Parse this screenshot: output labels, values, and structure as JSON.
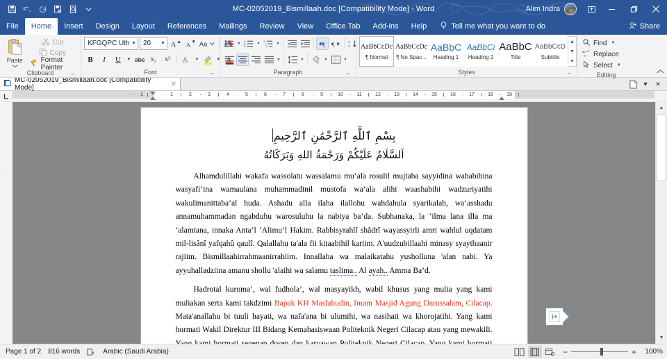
{
  "titlebar": {
    "quick_access": [
      "save-icon",
      "undo-icon",
      "redo-icon",
      "quick-print-icon",
      "print-preview-icon",
      "customize-qat-icon"
    ],
    "document_title": "MC-02052019_Bismillaah.doc [Compatibility Mode]  -  Word",
    "user_name": "Alim Indra",
    "ribbon_display_options": "ribbon-display-icon",
    "minimize": "minimize-icon",
    "restore": "restore-icon",
    "close": "close-icon"
  },
  "ribbon_tabs": [
    {
      "label": "File",
      "active": false
    },
    {
      "label": "Home",
      "active": true
    },
    {
      "label": "Insert",
      "active": false
    },
    {
      "label": "Design",
      "active": false
    },
    {
      "label": "Layout",
      "active": false
    },
    {
      "label": "References",
      "active": false
    },
    {
      "label": "Mailings",
      "active": false
    },
    {
      "label": "Review",
      "active": false
    },
    {
      "label": "View",
      "active": false
    },
    {
      "label": "Office Tab",
      "active": false
    },
    {
      "label": "Add-ins",
      "active": false
    },
    {
      "label": "Help",
      "active": false
    }
  ],
  "tell_me": {
    "placeholder": "Tell me what you want to do",
    "icon": "lightbulb-icon"
  },
  "share": {
    "label": "Share",
    "icon": "share-person-icon"
  },
  "ribbon": {
    "clipboard": {
      "label": "Clipboard",
      "paste_label": "Paste",
      "cut_label": "Cut",
      "copy_label": "Copy",
      "format_painter_label": "Format Painter",
      "dialog_launcher": "dialog-launcher-icon"
    },
    "font": {
      "label": "Font",
      "font_name": "KFGQPC Uth",
      "font_size": "20",
      "grow_font": "A",
      "shrink_font": "A",
      "change_case": "Aa",
      "clear_formatting": "clear-formatting-icon",
      "bold": "B",
      "italic": "I",
      "underline": "U",
      "strikethrough": "abc",
      "subscript": "x₂",
      "superscript": "x²",
      "text_effects": "text-effects-icon",
      "highlight": "highlight-icon",
      "font_color": "A",
      "dialog_launcher": "dialog-launcher-icon"
    },
    "paragraph": {
      "label": "Paragraph",
      "buttons_row1": [
        "bullets-icon",
        "numbering-icon",
        "multilevel-list-icon",
        "decrease-indent-icon",
        "increase-indent-icon",
        "ltr-text-direction-icon",
        "rtl-text-direction-icon",
        "sort-icon",
        "show-formatting-marks-icon"
      ],
      "buttons_row2": [
        "align-left-icon",
        "align-center-icon",
        "align-right-icon",
        "justify-icon",
        "line-spacing-icon",
        "shading-icon",
        "borders-icon"
      ],
      "dialog_launcher": "dialog-launcher-icon"
    },
    "styles": {
      "label": "Styles",
      "items": [
        {
          "preview": "AaBbCcDc",
          "name": "¶ Normal",
          "selected": true
        },
        {
          "preview": "AaBbCcDc",
          "name": "¶ No Spac...",
          "selected": false
        },
        {
          "preview": "AaBbC",
          "name": "Heading 1",
          "selected": false
        },
        {
          "preview": "AaBbCi",
          "name": "Heading 2",
          "selected": false
        },
        {
          "preview": "AaBbC",
          "name": "Title",
          "selected": false
        },
        {
          "preview": "AaBbCcD",
          "name": "Subtitle",
          "selected": false
        }
      ],
      "dialog_launcher": "dialog-launcher-icon"
    },
    "editing": {
      "label": "Editing",
      "find_label": "Find",
      "replace_label": "Replace",
      "select_label": "Select",
      "find_icon": "magnifier-icon",
      "replace_icon": "replace-abc-icon",
      "select_icon": "cursor-select-icon",
      "collapse_ribbon": "chevron-up-icon"
    }
  },
  "doc_tab_bar": {
    "tab_label": "MC-02052019_Bismillaah.doc [Compatibility Mode]",
    "tab_icon": "word-doc-icon",
    "tab_close": "close-small-icon",
    "new_tab": "new-document-icon",
    "tab_menu": "chevron-down-icon",
    "close_all": "close-icon"
  },
  "ruler": {
    "tab_stop_selector": "left-tab-stop-icon",
    "left_ticks": [
      "1"
    ],
    "ticks": [
      "1",
      "2",
      "3",
      "4",
      "5",
      "6",
      "7",
      "8",
      "9",
      "10",
      "11",
      "12",
      "13",
      "14",
      "15",
      "16",
      "17",
      "18",
      "19"
    ]
  },
  "document": {
    "arabic_line_1": "بِسْمِ ٱللَّهِ ٱلرَّحْمَٰنِ ٱلرَّحِيمِ",
    "arabic_line_2": "اَلسَّلَامُ عَلَيْكُمْ وَرَحْمَةُ اللهِ وَبَرَكَاتُهُ",
    "paragraph_1_a": "Alhamdulillahi wakafa wassolatu wassalamu mu’ala rosulil mujtaba sayyidina wahabibina wasyafi’ina wamaulana muhammadinil mustofa wa’ala alihi waashabihi wadzuriyatihi wakulimanittaba’al huda. Ashadu alla ilaha ilallohu wahdahula syarikalah, wa’asshadu annamuhammadan ngabduhu warosuluhu la nabiya ba’da. Subhanaka, la ‘ilma lana illa ma ‘alamtana, innaka Anta’l ‘Alimu’l Hakim. Rabbisyrahlî shâdrî wayassyirli amri wahlul uqdatam mil-lisânî yafqahû qaulî. Qalallahu ta'ala fii kitaabihil kariim. A'uudzubillaahi minasy syaythaanir rajiim. Bismillaahirrahmaanirrahiim. Innallaha wa malaikatahu yusholluna 'alan nabi. Ya ayyuhalladziina amanu shollu 'alaihi wa salamu ",
    "paragraph_1_err1": "taslima..",
    "paragraph_1_mid": " Al ",
    "paragraph_1_err2": "ayah..",
    "paragraph_1_end": " Amma Ba’d.",
    "paragraph_2_a": "Hadrotal kuroma’, wal fudhola’, wal masyayikh, wabil khusus yang mulia yang kami muliakan serta kami takdzimi ",
    "paragraph_2_red": "Bapak KH Maslahudin, Imam Masjid Agung Darussalam, Cilacap",
    "paragraph_2_b": ". Mata'anallahu bi tuuli hayati, wa nafa'ana bi ulumihi, wa nasihati wa khorojatihi. Yang kami hormati Wakil Direktur III Bidang Kemahasiswaan Politeknik Negeri Cilacap atau yang mewakili. Yang kami hormati segenap dosen dan karyawan Politeknik Negeri Cilacap. Yang kami hormati segenap tamu undangan dan para hadirin yang"
  },
  "status_bar": {
    "page_label": "Page 1 of 2",
    "words_label": "816 words",
    "proofing_icon": "proofing-errors-icon",
    "language_label": "Arabic (Saudi Arabia)",
    "view_read_mode": "read-mode-icon",
    "view_print_layout": "print-layout-icon",
    "view_web_layout": "web-layout-icon",
    "zoom_out": "−",
    "zoom_in": "+",
    "zoom_level": "100%"
  },
  "colors": {
    "word_blue": "#2b579a",
    "ribbon_bg": "#f3f3f3",
    "accent_red": "#e8301a",
    "heading_blue": "#2e74b5"
  }
}
